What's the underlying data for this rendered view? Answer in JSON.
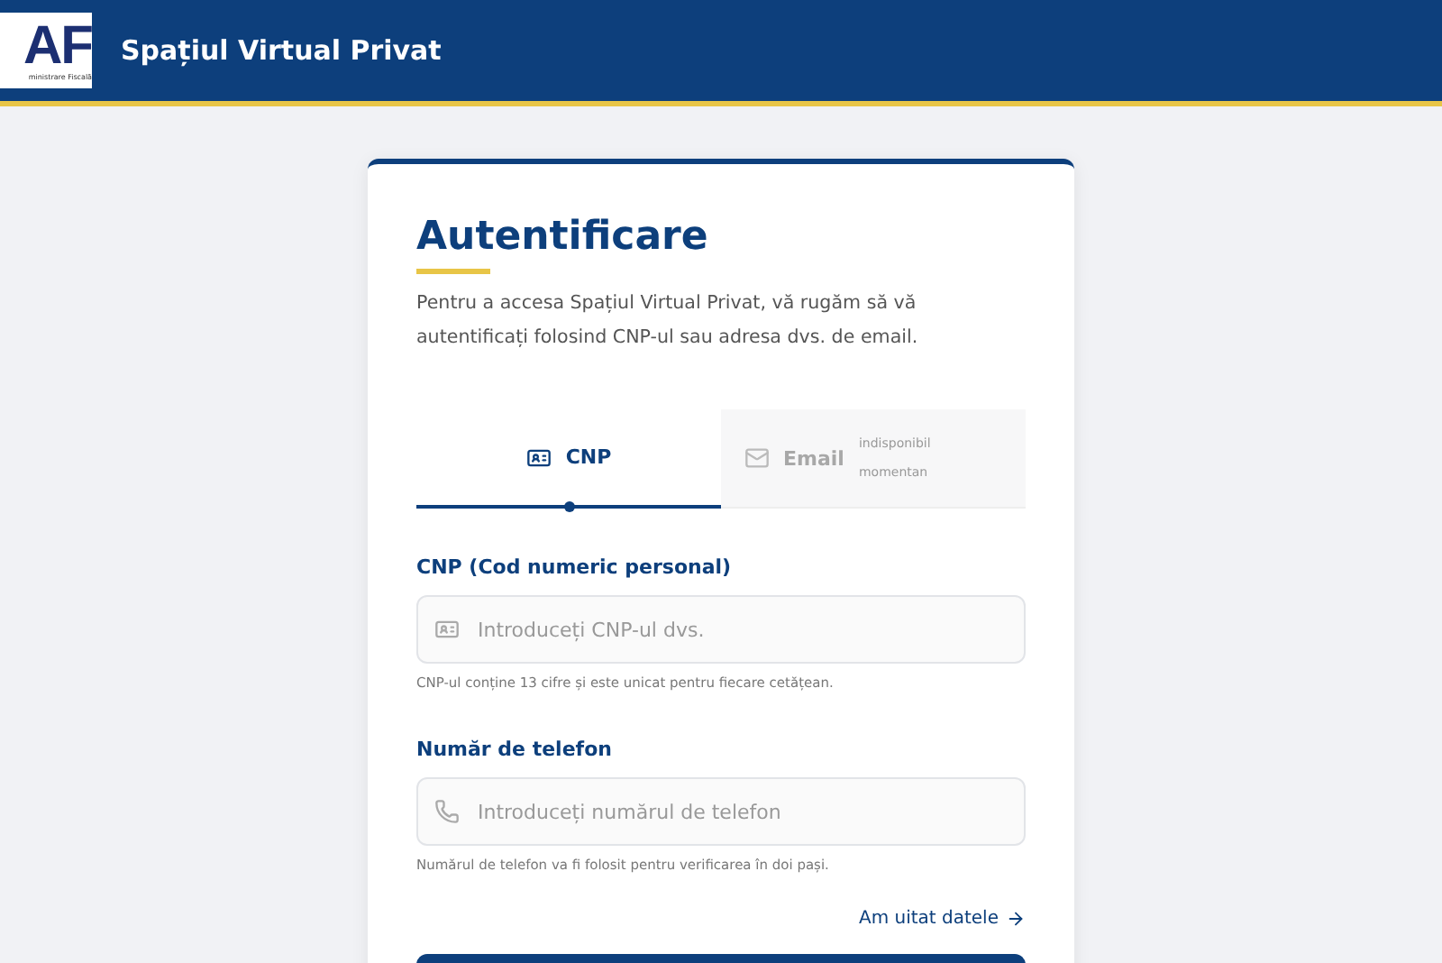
{
  "header": {
    "logo": {
      "mark": "AF",
      "caption": "ministrare Fiscală"
    },
    "title": "Spațiul Virtual Privat"
  },
  "card": {
    "title": "Autentificare",
    "intro": "Pentru a accesa Spațiul Virtual Privat, vă rugăm să vă autentificați folosind CNP-ul sau adresa dvs. de email.",
    "tabs": [
      {
        "kind": "id",
        "label": "CNP",
        "selected": true,
        "disabled": false
      },
      {
        "kind": "mail",
        "label": "Email",
        "note": "indisponibil momentan",
        "selected": false,
        "disabled": true
      }
    ],
    "fields": [
      {
        "kind": "id",
        "label": "CNP (Cod numeric personal)",
        "placeholder": "Introduceți CNP-ul dvs.",
        "hint": "CNP-ul conține 13 cifre și este unicat pentru fiecare cetățean."
      },
      {
        "kind": "phone",
        "label": "Număr de telefon",
        "placeholder": "Introduceți numărul de telefon",
        "hint": "Numărul de telefon va fi folosit pentru verificarea în doi pași."
      }
    ],
    "forgot_link": "Am uitat datele"
  }
}
